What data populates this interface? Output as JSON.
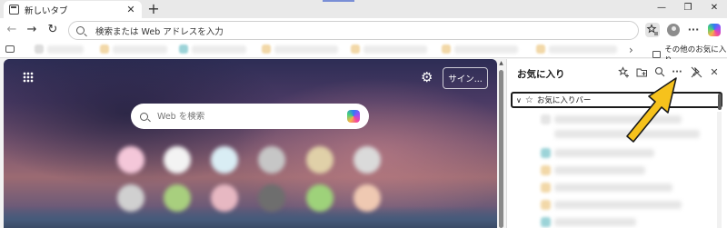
{
  "tab": {
    "title": "新しいタブ",
    "close": "✕"
  },
  "toolbar": {
    "new_tab": "+",
    "back": "←",
    "forward": "→",
    "refresh": "↻",
    "more": "···"
  },
  "window": {
    "minimize": "—",
    "maximize": "❐",
    "close": "✕"
  },
  "address_bar": {
    "text": "検索または Web アドレスを入力"
  },
  "bookmarks_bar": {
    "overflow": "›",
    "other_favorites": "その他のお気に入り"
  },
  "new_tab_page": {
    "settings_icon": "⚙",
    "sign_in_label": "サイン...",
    "search_placeholder": "Web を検索"
  },
  "favorites_panel": {
    "title": "お気に入り",
    "more_label": "···",
    "close": "✕",
    "folder_label": "お気に入りバー",
    "expand": "∨",
    "star": "☆"
  },
  "colors": {
    "annotation_arrow": "#f6c21c",
    "annotation_outline": "#1b1b1b"
  }
}
